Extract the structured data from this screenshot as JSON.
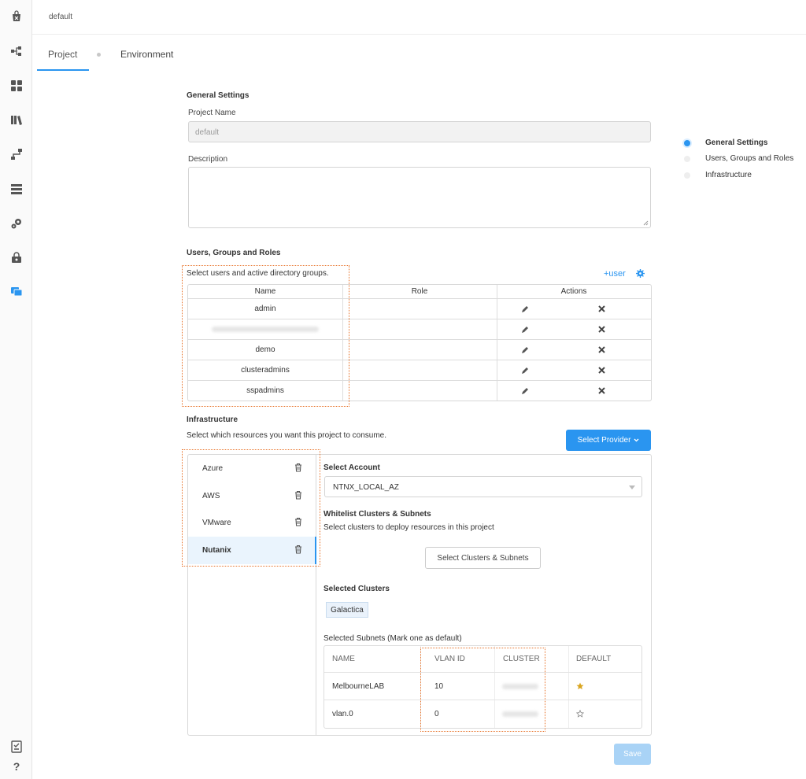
{
  "header": {
    "project_label": "default"
  },
  "tabs": [
    {
      "label": "Project"
    },
    {
      "label": "Environment"
    }
  ],
  "general": {
    "title": "General Settings",
    "project_name_label": "Project Name",
    "project_name_value": "default",
    "description_label": "Description",
    "description_value": ""
  },
  "users": {
    "title": "Users, Groups and Roles",
    "subtitle": "Select users and active directory groups.",
    "add_user_label": "+user",
    "columns": [
      "Name",
      "Role",
      "Actions"
    ],
    "rows": [
      {
        "name": "admin",
        "role": ""
      },
      {
        "name": "",
        "role": ""
      },
      {
        "name": "demo",
        "role": ""
      },
      {
        "name": "clusteradmins",
        "role": ""
      },
      {
        "name": "sspadmins",
        "role": ""
      }
    ]
  },
  "right_nav": [
    {
      "label": "General Settings",
      "active": true
    },
    {
      "label": "Users, Groups and Roles",
      "active": false
    },
    {
      "label": "Infrastructure",
      "active": false
    }
  ],
  "infra": {
    "title": "Infrastructure",
    "subtitle": "Select which resources you want this project to consume.",
    "select_provider_label": "Select Provider",
    "providers": [
      {
        "label": "Azure",
        "active": false
      },
      {
        "label": "AWS",
        "active": false
      },
      {
        "label": "VMware",
        "active": false
      },
      {
        "label": "Nutanix",
        "active": true
      }
    ],
    "select_account_label": "Select Account",
    "account_value": "NTNX_LOCAL_AZ",
    "whitelist_title": "Whitelist Clusters & Subnets",
    "whitelist_subtitle": "Select clusters to deploy resources in this project",
    "select_clusters_button": "Select Clusters & Subnets",
    "selected_clusters_label": "Selected Clusters",
    "clusters": [
      "Galactica"
    ],
    "selected_subnets_label": "Selected Subnets (Mark one as default)",
    "subnet_columns": [
      "NAME",
      "VLAN ID",
      "CLUSTER",
      "DEFAULT"
    ],
    "subnets": [
      {
        "name": "MelbourneLAB",
        "vlan": "10",
        "cluster": "",
        "default": true
      },
      {
        "name": "vlan.0",
        "vlan": "0",
        "cluster": "",
        "default": false
      }
    ]
  },
  "save_label": "Save",
  "colors": {
    "accent": "#2a95f0",
    "highlight_border": "#e8742c",
    "star": "#d9a520"
  },
  "icons": {
    "rail": [
      "marketplace-icon",
      "blueprints-icon",
      "apps-icon",
      "library-icon",
      "runbooks-icon",
      "endpoints-icon",
      "settings-icon",
      "policies-icon",
      "projects-icon"
    ],
    "rail_bottom": [
      "tasks-icon",
      "help-icon"
    ]
  }
}
